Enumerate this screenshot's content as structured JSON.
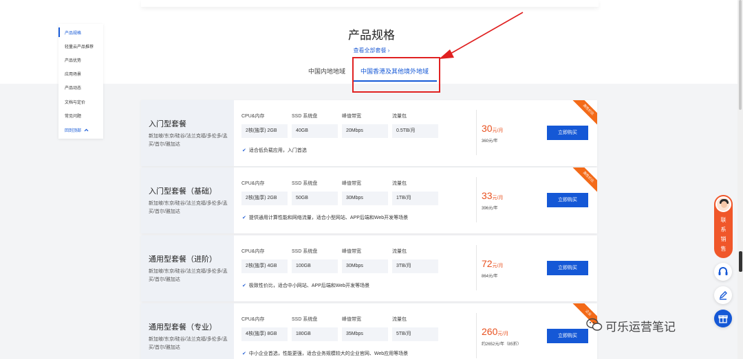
{
  "section": {
    "title": "产品规格",
    "view_all": "查看全部套餐 ›",
    "tabs": [
      {
        "label": "中国内地地域"
      },
      {
        "label": "中国香港及其他境外地域"
      }
    ]
  },
  "side_nav": {
    "items": [
      {
        "label": "产品规格"
      },
      {
        "label": "轻量云产品推荐"
      },
      {
        "label": "产品优势"
      },
      {
        "label": "应用场景"
      },
      {
        "label": "产品动态"
      },
      {
        "label": "文档与定价"
      },
      {
        "label": "常见问题"
      }
    ],
    "back_to_top": "回到顶部"
  },
  "spec_labels": [
    "CPU&内存",
    "SSD 系统盘",
    "峰值带宽",
    "流量包"
  ],
  "cards": [
    {
      "name": "入门型套餐",
      "regions": "新加坡/东京/硅谷/法兰克福/多伦多/孟买/首尔/雅加达",
      "specs": [
        "2核(独享) 2GB",
        "40GB",
        "20Mbps",
        "0.5TB/月"
      ],
      "desc": "适合低负载应用，入门首选",
      "price": "30",
      "price_unit": "元/月",
      "year_price": "360元/年",
      "ribbon": "高性价比",
      "buy_label": "立即购买"
    },
    {
      "name": "入门型套餐（基础）",
      "regions": "新加坡/东京/硅谷/法兰克福/多伦多/孟买/首尔/雅加达",
      "specs": [
        "2核(独享) 2GB",
        "50GB",
        "30Mbps",
        "1TB/月"
      ],
      "desc": "提供通用计算性能和网络流量，适合小型网站、APP后端和Web开发等场景",
      "price": "33",
      "price_unit": "元/月",
      "year_price": "396元/年",
      "ribbon": "高性价比",
      "buy_label": "立即购买"
    },
    {
      "name": "通用型套餐（进阶）",
      "regions": "新加坡/东京/硅谷/法兰克福/多伦多/孟买/首尔/雅加达",
      "specs": [
        "2核(独享) 4GB",
        "100GB",
        "30Mbps",
        "3TB/月"
      ],
      "desc": "极致性价比，适合中小网站、APP后端和Web开发等场景",
      "price": "72",
      "price_unit": "元/月",
      "year_price": "864元/年",
      "ribbon": "",
      "buy_label": "立即购买"
    },
    {
      "name": "通用型套餐（专业）",
      "regions": "新加坡/东京/硅谷/法兰克福/多伦多/孟买/首尔/雅加达",
      "specs": [
        "4核(独享) 8GB",
        "180GB",
        "35Mbps",
        "5TB/月"
      ],
      "desc": "中小企业首选，性能更强，适合业务规模较大的企业官网、Web应用等场景",
      "price": "260",
      "price_unit": "元/月",
      "year_price": "约2652元/年（85折）",
      "ribbon": "企业",
      "buy_label": "立即购买"
    }
  ],
  "contact_sales": "联系销售",
  "watermark": "可乐运营笔记",
  "colors": {
    "primary": "#1558d6",
    "price": "#e8501e",
    "annotation": "#e02020",
    "ribbon": "#f36a18"
  }
}
